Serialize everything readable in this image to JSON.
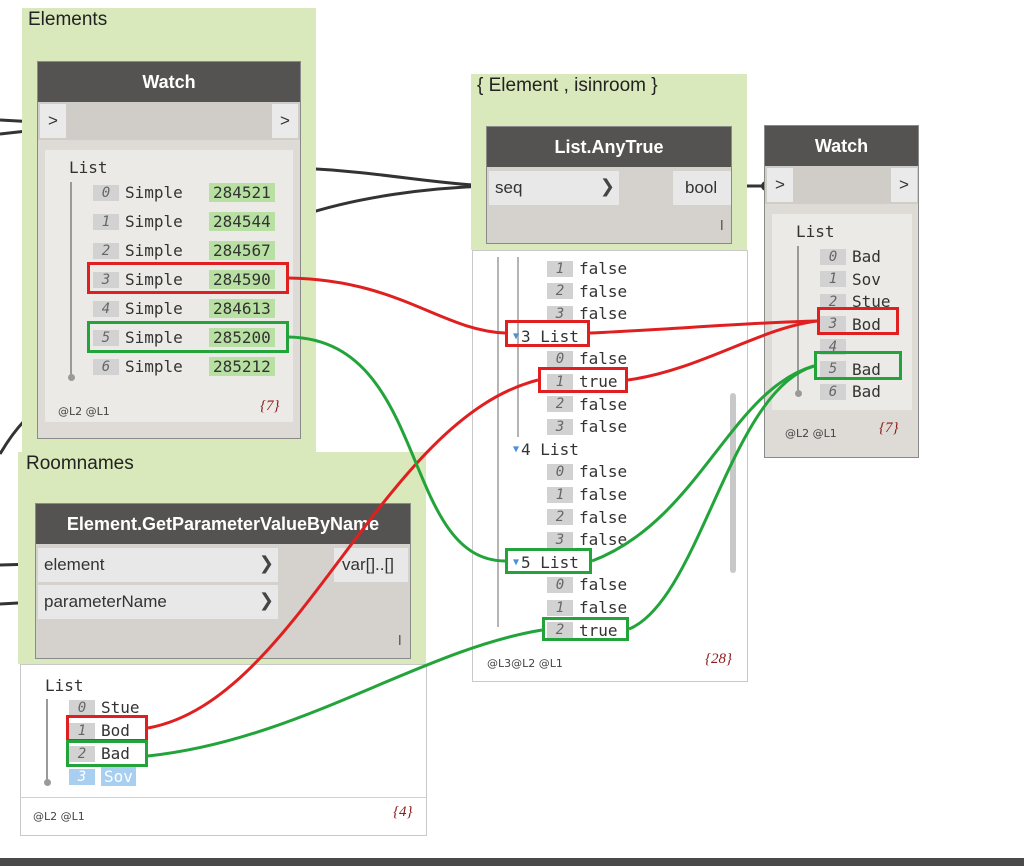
{
  "colors": {
    "group_bg": "#d9e9bb",
    "node_title_bg": "#555351",
    "highlight_red": "#e02020",
    "highlight_green": "#22a43a",
    "value_green_bg": "#b8e0a2",
    "selected_blue_bg": "#a8cff0"
  },
  "groups": {
    "elements": {
      "title": "Elements"
    },
    "anytrue_group": {
      "title": "{ Element , isinroom }"
    },
    "roomnames": {
      "title": "Roomnames"
    }
  },
  "watch1": {
    "title": "Watch",
    "in_label": ">",
    "out_label": ">",
    "list_label": "List",
    "items": [
      {
        "index": "0",
        "type": "Simple",
        "value": "284521"
      },
      {
        "index": "1",
        "type": "Simple",
        "value": "284544"
      },
      {
        "index": "2",
        "type": "Simple",
        "value": "284567"
      },
      {
        "index": "3",
        "type": "Simple",
        "value": "284590"
      },
      {
        "index": "4",
        "type": "Simple",
        "value": "284613"
      },
      {
        "index": "5",
        "type": "Simple",
        "value": "285200"
      },
      {
        "index": "6",
        "type": "Simple",
        "value": "285212"
      }
    ],
    "footer": "@L2 @L1",
    "count": "{7}"
  },
  "anytrue": {
    "title": "List.AnyTrue",
    "input": "seq",
    "output": "bool",
    "lacing": "l",
    "preview": {
      "rows": [
        {
          "index": "1",
          "value": "false"
        },
        {
          "index": "2",
          "value": "false"
        },
        {
          "index": "3",
          "value": "false"
        }
      ],
      "list3": "3 List",
      "list3_rows": [
        {
          "index": "0",
          "value": "false"
        },
        {
          "index": "1",
          "value": "true"
        },
        {
          "index": "2",
          "value": "false"
        },
        {
          "index": "3",
          "value": "false"
        }
      ],
      "list4": "4 List",
      "list4_rows": [
        {
          "index": "0",
          "value": "false"
        },
        {
          "index": "1",
          "value": "false"
        },
        {
          "index": "2",
          "value": "false"
        },
        {
          "index": "3",
          "value": "false"
        }
      ],
      "list5": "5 List",
      "list5_rows": [
        {
          "index": "0",
          "value": "false"
        },
        {
          "index": "1",
          "value": "false"
        },
        {
          "index": "2",
          "value": "true"
        }
      ],
      "footer": "@L3@L2 @L1",
      "count": "{28}"
    }
  },
  "watch2": {
    "title": "Watch",
    "in_label": ">",
    "out_label": ">",
    "list_label": "List",
    "items": [
      {
        "index": "0",
        "value": "Bad"
      },
      {
        "index": "1",
        "value": "Sov"
      },
      {
        "index": "2",
        "value": "Stue"
      },
      {
        "index": "3",
        "value": "Bod"
      },
      {
        "index": "4",
        "value": ""
      },
      {
        "index": "5",
        "value": "Bad"
      },
      {
        "index": "6",
        "value": "Bad"
      }
    ],
    "footer": "@L2 @L1",
    "count": "{7}"
  },
  "getparam": {
    "title": "Element.GetParameterValueByName",
    "inputs": [
      "element",
      "parameterName"
    ],
    "output": "var[]..[]",
    "lacing": "l",
    "preview": {
      "list_label": "List",
      "items": [
        {
          "index": "0",
          "value": "Stue"
        },
        {
          "index": "1",
          "value": "Bod"
        },
        {
          "index": "2",
          "value": "Bad"
        },
        {
          "index": "3",
          "value": "Sov"
        }
      ],
      "footer": "@L2 @L1",
      "count": "{4}"
    }
  }
}
